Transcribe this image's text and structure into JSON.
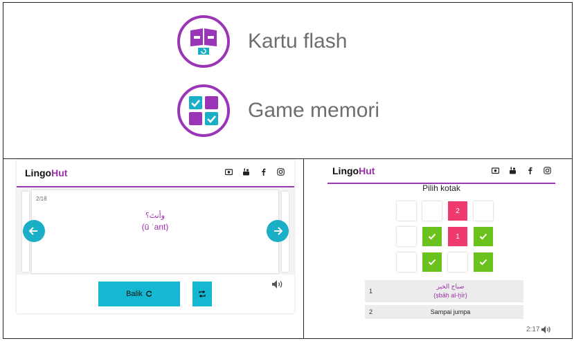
{
  "features": [
    {
      "label": "Kartu flash",
      "icon": "flashcard-icon"
    },
    {
      "label": "Game memori",
      "icon": "memory-game-icon"
    }
  ],
  "brand": {
    "logo_prefix": "Lingo",
    "logo_suffix": "Hut",
    "accent": "#9b35b8",
    "cyan": "#14b8d2"
  },
  "flashcard": {
    "counter": "2/18",
    "arabic": "وأنتَ؟",
    "transliteration": "(ū ʾant)",
    "flip_label": "Balik"
  },
  "memory_game": {
    "title": "Pilih kotak",
    "grid": [
      [
        "blank",
        "blank",
        "2",
        "blank"
      ],
      [
        "blank",
        "check",
        "1",
        "check"
      ],
      [
        "blank",
        "check",
        "blank",
        "check"
      ]
    ],
    "rows": [
      {
        "num": "1",
        "arabic": "صباح الخير",
        "transliteration": "(ṣbāḥ al-ḫīr)"
      },
      {
        "num": "2",
        "text": "Sampai jumpa"
      }
    ],
    "timer": "2:17"
  },
  "socials": [
    "camera-icon",
    "youtube-icon",
    "facebook-icon",
    "instagram-icon"
  ]
}
